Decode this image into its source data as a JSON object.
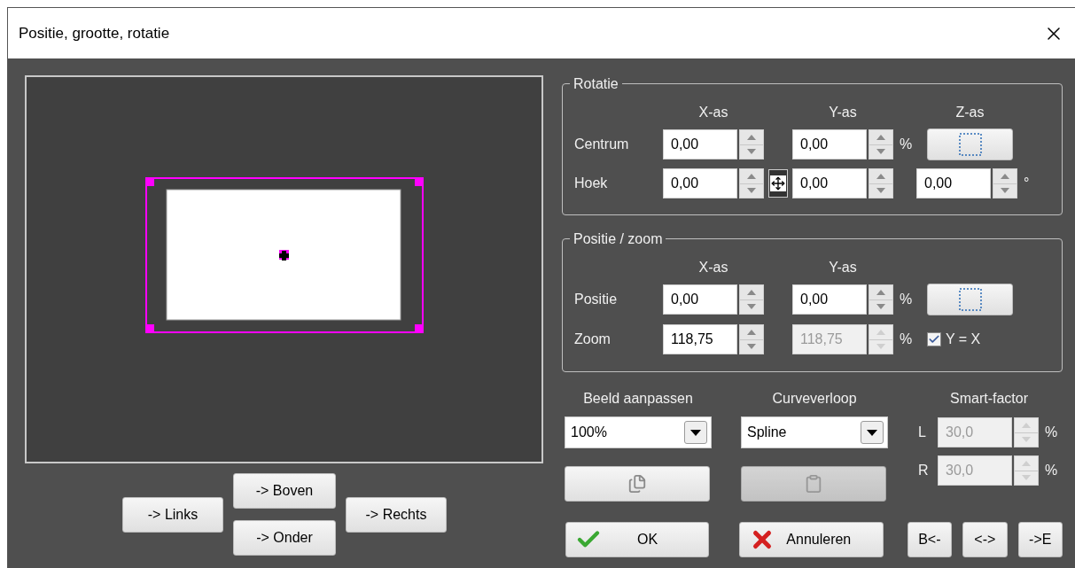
{
  "window": {
    "title": "Positie, grootte, rotatie"
  },
  "nav_buttons": {
    "left": "-> Links",
    "up": "-> Boven",
    "down": "-> Onder",
    "right": "-> Rechts"
  },
  "rotation": {
    "legend": "Rotatie",
    "headers": [
      "X-as",
      "Y-as",
      "Z-as"
    ],
    "center": {
      "label": "Centrum",
      "x": {
        "value": "0,00",
        "disabled": false
      },
      "y": {
        "value": "0,00",
        "disabled": false
      },
      "unit": "%"
    },
    "angle": {
      "label": "Hoek",
      "x": {
        "value": "0,00",
        "disabled": false
      },
      "linked": false,
      "y": {
        "value": "0,00",
        "disabled": false
      },
      "z": {
        "value": "0,00",
        "disabled": false
      },
      "unit": "°"
    }
  },
  "position": {
    "legend": "Positie / zoom",
    "headers": [
      "X-as",
      "Y-as"
    ],
    "position": {
      "label": "Positie",
      "x": {
        "value": "0,00",
        "disabled": false
      },
      "y": {
        "value": "0,00",
        "disabled": false
      },
      "unit": "%"
    },
    "zoom": {
      "label": "Zoom",
      "x": {
        "value": "118,75",
        "disabled": false
      },
      "y": {
        "value": "118,75",
        "disabled": true
      },
      "unit": "%",
      "lock": {
        "label": "Y = X",
        "checked": true
      }
    }
  },
  "fit": {
    "label": "Beeld aanpassen",
    "value": "100%"
  },
  "curve": {
    "label": "Curveverloop",
    "value": "Spline"
  },
  "smart": {
    "label": "Smart-factor",
    "rows": [
      {
        "label": "L",
        "value": "30,0",
        "disabled": true,
        "unit": "%"
      },
      {
        "label": "R",
        "value": "30,0",
        "disabled": true,
        "unit": "%"
      }
    ]
  },
  "clipboard": {
    "paste_disabled": true
  },
  "buttons": {
    "ok": "OK",
    "cancel": "Annuleren",
    "begin": "B<-",
    "both": "<->",
    "end": "->E"
  }
}
